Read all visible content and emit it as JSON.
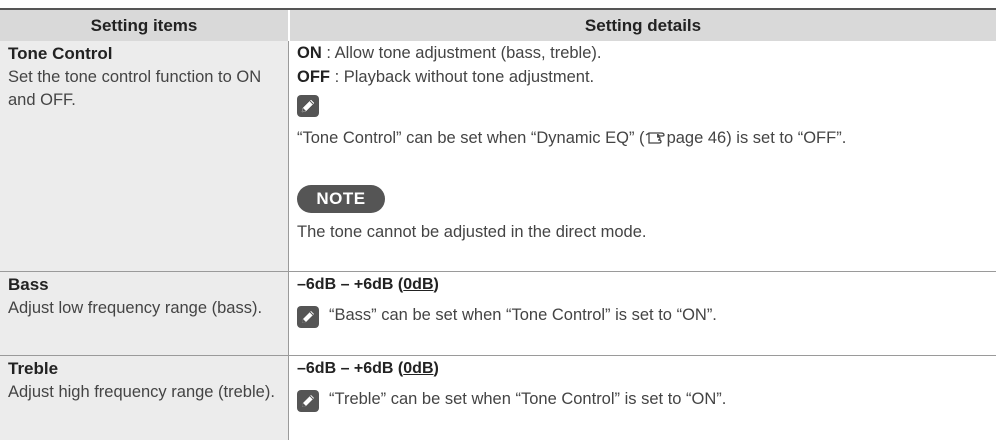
{
  "table": {
    "headers": {
      "items": "Setting items",
      "details": "Setting details"
    },
    "rows": [
      {
        "name": "Tone Control",
        "description": "Set the tone control function to ON and OFF.",
        "on_label": "ON",
        "on_text": " : Allow tone adjustment (bass, treble).",
        "off_label": "OFF",
        "off_text": " : Playback without tone adjustment.",
        "hint_pre": "“Tone Control” can be set when “Dynamic EQ” (",
        "hint_post": "page 46) is set to “OFF”.",
        "note_label": "NOTE",
        "note_text": "The tone cannot be adjusted in the direct mode."
      },
      {
        "name": "Bass",
        "description": "Adjust low frequency range (bass).",
        "range_pre": "–6dB – +6dB (",
        "range_default": "0dB",
        "range_post": ")",
        "hint": "“Bass” can be set when “Tone Control” is set to “ON”."
      },
      {
        "name": "Treble",
        "description": "Adjust high frequency range (treble).",
        "range_pre": "–6dB – +6dB (",
        "range_default": "0dB",
        "range_post": ")",
        "hint": "“Treble” can be set when “Tone Control” is set to “ON”."
      }
    ]
  },
  "icons": {
    "hint": "pencil-icon",
    "page_ref": "pointing-hand-icon"
  },
  "colors": {
    "header_bg": "#d9d9d9",
    "item_col_bg": "#ececec",
    "badge_bg": "#555555"
  }
}
